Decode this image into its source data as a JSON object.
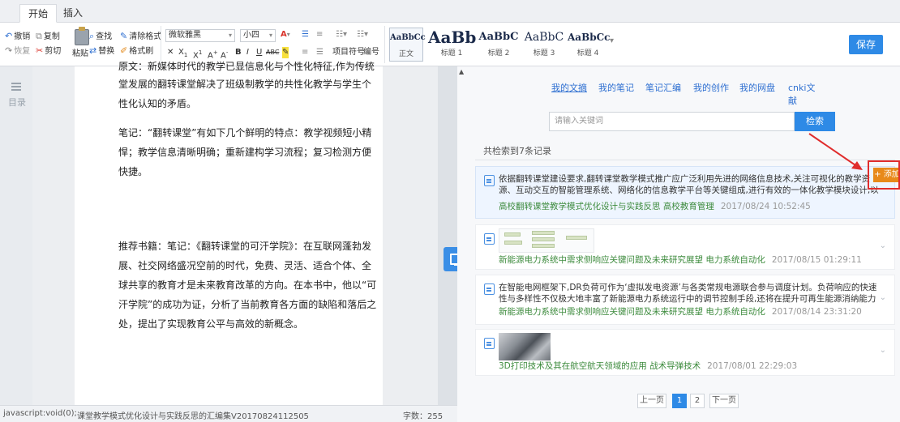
{
  "tabs": [
    "开始",
    "插入"
  ],
  "toolbar": {
    "undo": "撤销",
    "copy": "复制",
    "redo": "恢复",
    "cut": "剪切",
    "paste": "粘贴",
    "find": "查找",
    "clear_format": "清除格式",
    "replace": "替换",
    "format_painter": "格式刷",
    "font_family": "微软雅黑",
    "font_size": "小四",
    "bullets": "项目符号",
    "numbering": "编号",
    "styles": [
      {
        "sample": "AaBbCc",
        "label": "正文"
      },
      {
        "sample": "AaBb",
        "label": "标题 1"
      },
      {
        "sample": "AaBbC",
        "label": "标题 2"
      },
      {
        "sample": "AaBbC",
        "label": "标题 3"
      },
      {
        "sample": "AaBbCc",
        "label": "标题 4"
      }
    ],
    "save": "保存"
  },
  "toc_label": "目录",
  "document": {
    "line_top": "原文：新媒体时代的教学已显信息化与个性化特征,作为传统课",
    "para1": "堂发展的翻转课堂解决了班级制教学的共性化教学与学生个性化认知的矛盾。",
    "para2": "笔记：“翻转课堂”有如下几个鲜明的特点：教学视频短小精悍；教学信息清晰明确；重新建构学习流程；复习检测方便快捷。",
    "para3": "推荐书籍：笔记：《翻转课堂的可汗学院》：在互联网蓬勃发展、社交网络盛况空前的时代，免费、灵活、适合个体、全球共享的教育才是未来教育改革的方向。在本书中，他以“可汗学院”的成功为证，分析了当前教育各方面的缺陷和落后之处，提出了实现教育公平与高效的新概念。"
  },
  "right_tabs": [
    "我的文摘",
    "我的笔记",
    "笔记汇编",
    "我的创作",
    "我的网盘",
    "cnki文献"
  ],
  "search": {
    "placeholder": "请输入关键词",
    "button": "检索"
  },
  "result_count": "共检索到7条记录",
  "results": [
    {
      "text": "依据翻转课堂建设要求,翻转课堂教学模式推广应广泛利用先进的网络信息技术,关注可视化的教学资源、互动交互的智能管理系统、网络化的信息教学平台等关键组成,进行有效的一体化教学模块设计,以克服不",
      "source": "高校翻转课堂教学模式优化设计与实践反思 高校教育管理",
      "date": "2017/08/24 10:52:45"
    },
    {
      "text": "",
      "source": "新能源电力系统中需求侧响应关键问题及未来研究展望 电力系统自动化",
      "date": "2017/08/15 01:29:11"
    },
    {
      "text": "在智能电网框架下,DR负荷可作为‘虚拟发电资源’与各类常规电源联合参与调度计划。负荷响应的快速性与多样性不仅极大地丰富了新能源电力系统运行中的调节控制手段,还将在提升可再生能源消纳能力及电",
      "source": "新能源电力系统中需求侧响应关键问题及未来研究展望 电力系统自动化",
      "date": "2017/08/14 23:31:20"
    },
    {
      "text": "",
      "source": "3D打印技术及其在航空航天领域的应用 战术导弹技术",
      "date": "2017/08/01 22:29:03"
    }
  ],
  "add_button": "+ 添加",
  "pagination": {
    "prev": "上一页",
    "pages": [
      "1",
      "2"
    ],
    "current": "1",
    "next": "下一页"
  },
  "status": {
    "js_text": "javascript:void(0);",
    "filename": "课堂教学模式优化设计与实践反思的汇编集V20170824112505",
    "word_count": "字数：255"
  },
  "colors": {
    "accent": "#2e8ae6",
    "add": "#e88a1a",
    "source_green": "#3d8b3d",
    "annotation_red": "#e02d2d"
  }
}
